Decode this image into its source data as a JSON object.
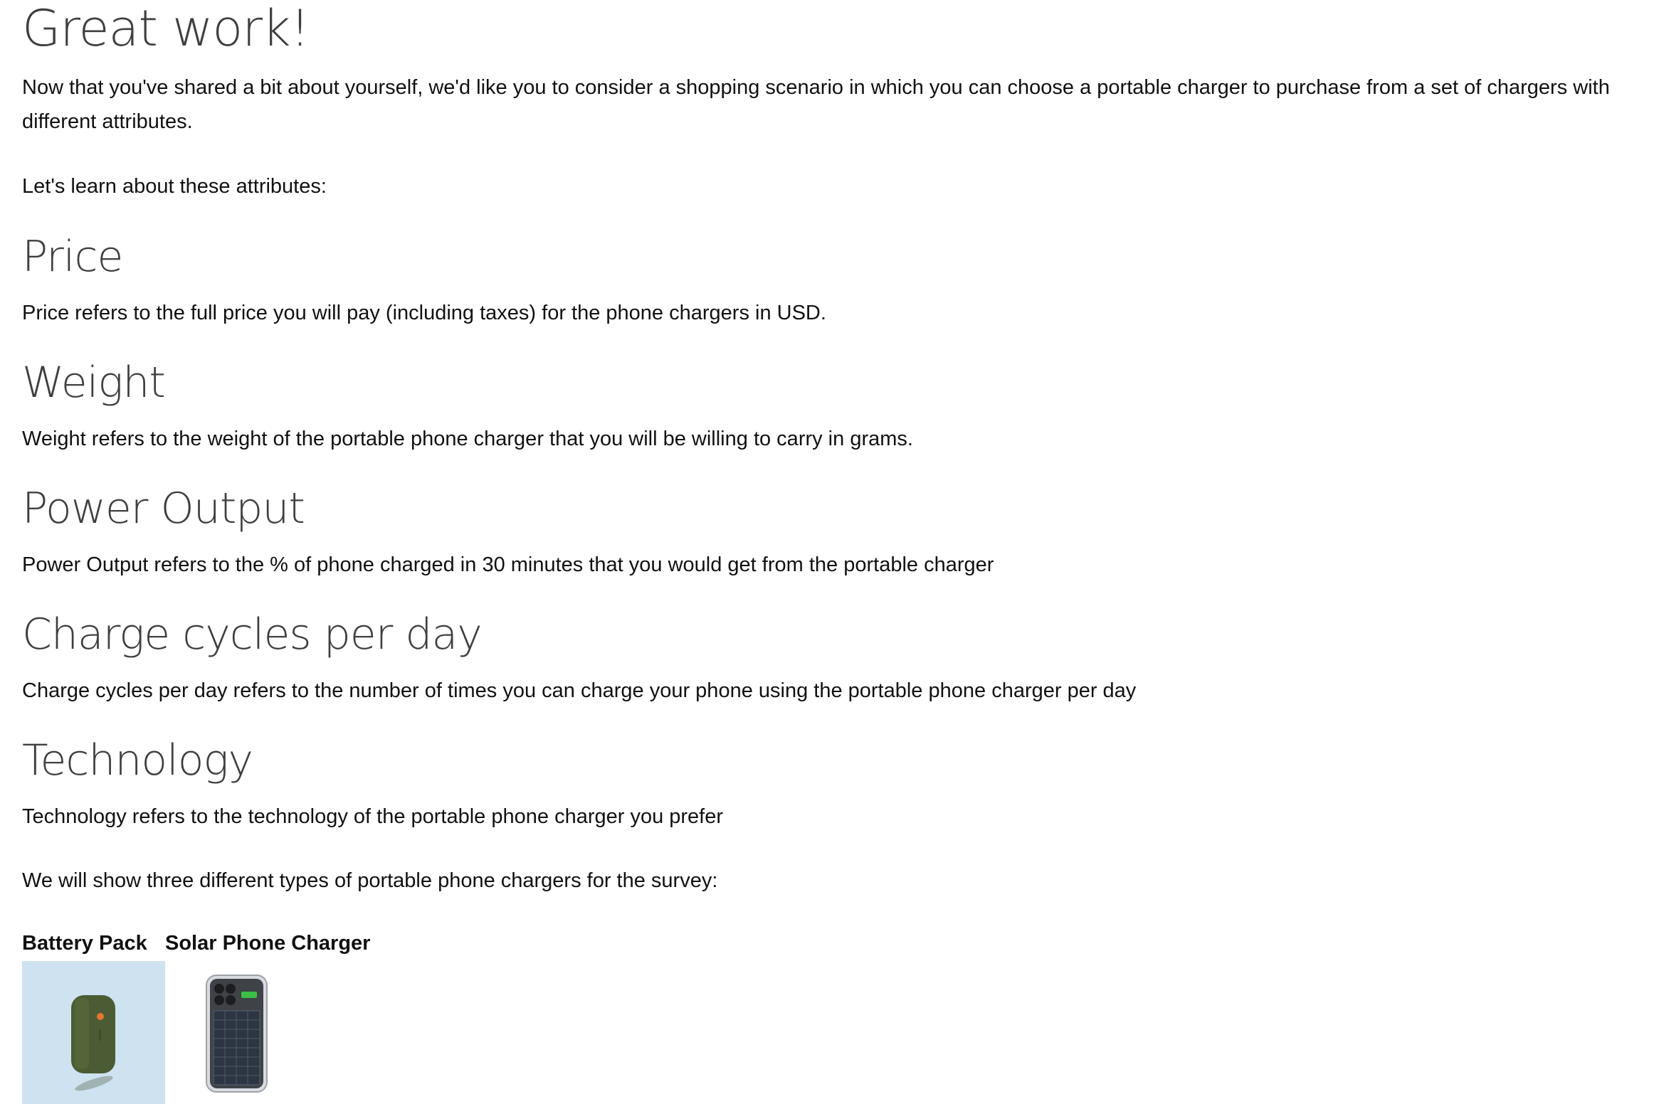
{
  "heading": "Great work!",
  "intro": "Now that you've shared a bit about yourself, we'd like you to consider a shopping scenario in which you can choose a portable charger to purchase from a set of chargers with different attributes.",
  "learn_prompt": "Let's learn about these attributes:",
  "attributes": [
    {
      "title": "Price",
      "description": "Price refers to the full price you will pay (including taxes) for the phone chargers in USD."
    },
    {
      "title": "Weight",
      "description": "Weight refers to the weight of the portable phone charger that you will be willing to carry in grams."
    },
    {
      "title": "Power Output",
      "description": "Power Output refers to the % of phone charged in 30 minutes that you would get from the portable charger"
    },
    {
      "title": "Charge cycles per day",
      "description": "Charge cycles per day refers to the number of times you can charge your phone using the portable phone charger per day"
    },
    {
      "title": "Technology",
      "description": "Technology refers to the technology of the portable phone charger you prefer"
    }
  ],
  "types_prompt": "We will show three different types of portable phone chargers for the survey:",
  "chargers": [
    {
      "label": "Battery Pack",
      "icon": "battery-pack-image"
    },
    {
      "label": "Solar Phone Charger",
      "icon": "solar-phone-charger-image"
    }
  ]
}
